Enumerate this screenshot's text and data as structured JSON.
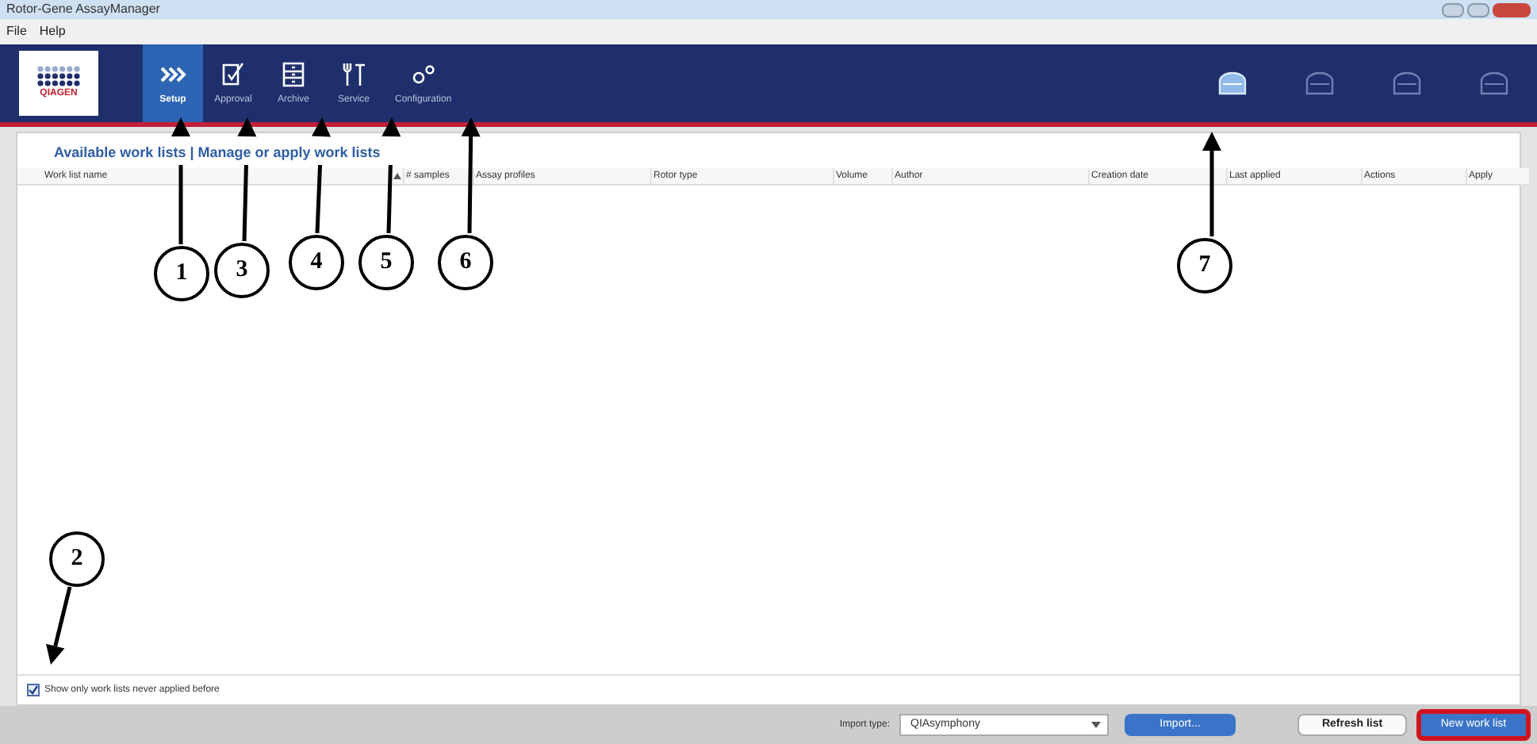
{
  "window": {
    "title": "Rotor-Gene AssayManager"
  },
  "menu": [
    "File",
    "Help"
  ],
  "logo": {
    "text": "QIAGEN"
  },
  "nav": [
    {
      "label": "Setup",
      "kind": "setup",
      "selected": true
    },
    {
      "label": "Approval",
      "kind": "approval",
      "selected": false
    },
    {
      "label": "Archive",
      "kind": "archive",
      "selected": false
    },
    {
      "label": "Service",
      "kind": "service",
      "selected": false
    },
    {
      "label": "Configuration",
      "kind": "configuration",
      "selected": false
    }
  ],
  "instruments": [
    {
      "selected": true
    },
    {
      "selected": false
    },
    {
      "selected": false
    },
    {
      "selected": false
    }
  ],
  "panel": {
    "title": "Available work lists | Manage or apply work lists"
  },
  "table": {
    "columns": [
      {
        "label": "Work list name",
        "sorted": true
      },
      {
        "label": "# samples",
        "sorted": false
      },
      {
        "label": "Assay profiles",
        "sorted": false
      },
      {
        "label": "Rotor type",
        "sorted": false
      },
      {
        "label": "Volume",
        "sorted": false
      },
      {
        "label": "Author",
        "sorted": false
      },
      {
        "label": "Creation date",
        "sorted": false
      },
      {
        "label": "Last applied",
        "sorted": false
      },
      {
        "label": "Actions",
        "sorted": false
      },
      {
        "label": "Apply",
        "sorted": false
      }
    ]
  },
  "filter": {
    "label": "Show only work lists never applied before",
    "checked": true
  },
  "footer": {
    "import_label": "Import type:",
    "import_value": "QIAsymphony",
    "import_button": "Import...",
    "refresh_button": "Refresh list",
    "new_button": "New work list",
    "new_highlighted": true
  },
  "callouts": [
    {
      "label": "1"
    },
    {
      "label": "3"
    },
    {
      "label": "4"
    },
    {
      "label": "5"
    },
    {
      "label": "6"
    },
    {
      "label": "7"
    },
    {
      "label": "2"
    }
  ]
}
